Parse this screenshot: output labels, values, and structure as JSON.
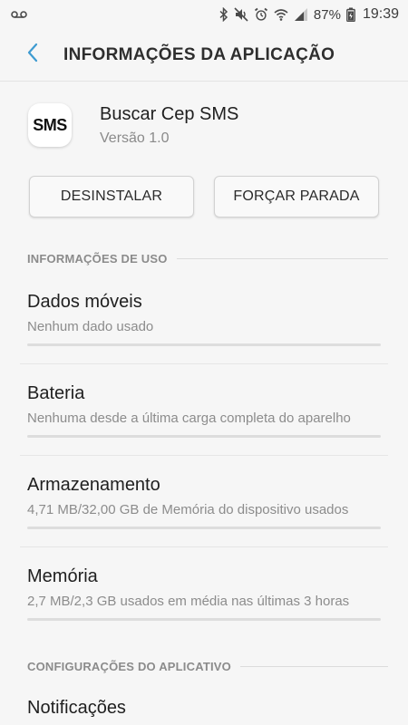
{
  "status_bar": {
    "battery_percent": "87%",
    "time": "19:39",
    "left_icons": [
      "voicemail-icon"
    ],
    "right_icons": [
      "bluetooth-icon",
      "mute-icon",
      "alarm-icon",
      "wifi-icon",
      "signal-icon",
      "battery-icon"
    ]
  },
  "header": {
    "title": "INFORMAÇÕES DA APLICAÇÃO",
    "back_icon": "back-arrow-icon",
    "accent_color": "#3e9bd1"
  },
  "app": {
    "icon_text": "SMS",
    "name": "Buscar Cep SMS",
    "version": "Versão 1.0"
  },
  "buttons": {
    "uninstall": "DESINSTALAR",
    "force_stop": "FORÇAR PARADA"
  },
  "usage_section": {
    "title": "INFORMAÇÕES DE USO",
    "items": [
      {
        "title": "Dados móveis",
        "subtitle": "Nenhum dado usado"
      },
      {
        "title": "Bateria",
        "subtitle": "Nenhuma desde a última carga completa do aparelho"
      },
      {
        "title": "Armazenamento",
        "subtitle": "4,71 MB/32,00 GB de Memória do dispositivo usados"
      },
      {
        "title": "Memória",
        "subtitle": "2,7 MB/2,3 GB usados em média nas últimas 3 horas"
      }
    ]
  },
  "config_section": {
    "title": "CONFIGURAÇÕES DO APLICATIVO",
    "items": [
      {
        "title": "Notificações"
      }
    ]
  }
}
